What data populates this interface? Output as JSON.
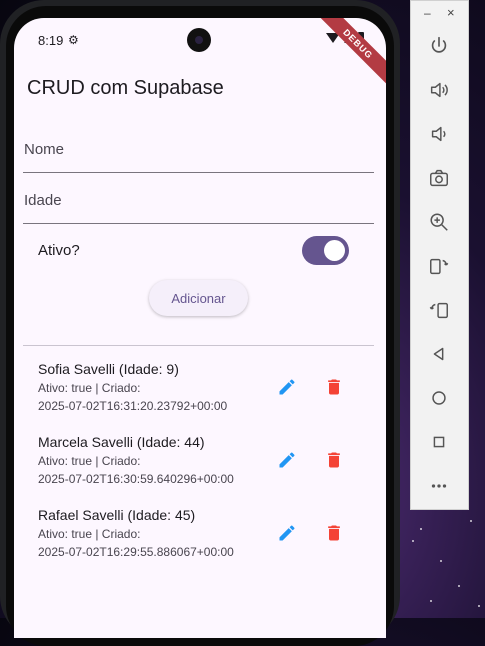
{
  "status_bar": {
    "time": "8:19"
  },
  "debug_banner": "DEBUG",
  "app": {
    "title": "CRUD com Supabase",
    "form": {
      "nome_label": "Nome",
      "idade_label": "Idade",
      "ativo_label": "Ativo?",
      "ativo_value": true,
      "add_button": "Adicionar"
    },
    "records": [
      {
        "title": "Sofia Savelli (Idade: 9)",
        "line1": "Ativo: true | Criado:",
        "line2": "2025-07-02T16:31:20.23792+00:00"
      },
      {
        "title": "Marcela Savelli (Idade: 44)",
        "line1": "Ativo: true | Criado:",
        "line2": "2025-07-02T16:30:59.640296+00:00"
      },
      {
        "title": "Rafael Savelli (Idade: 45)",
        "line1": "Ativo: true | Criado:",
        "line2": "2025-07-02T16:29:55.886067+00:00"
      }
    ]
  },
  "colors": {
    "primary": "#65558f",
    "edit": "#2196f3",
    "delete": "#f44336",
    "background": "#fdf7ff"
  },
  "emulator_panel": {
    "minimize": "–",
    "close": "×",
    "buttons": [
      "power-icon",
      "volume-up-icon",
      "volume-down-icon",
      "camera-icon",
      "zoom-icon",
      "rotate-left-icon",
      "rotate-right-icon",
      "back-icon",
      "home-icon",
      "overview-icon",
      "more-icon"
    ]
  }
}
